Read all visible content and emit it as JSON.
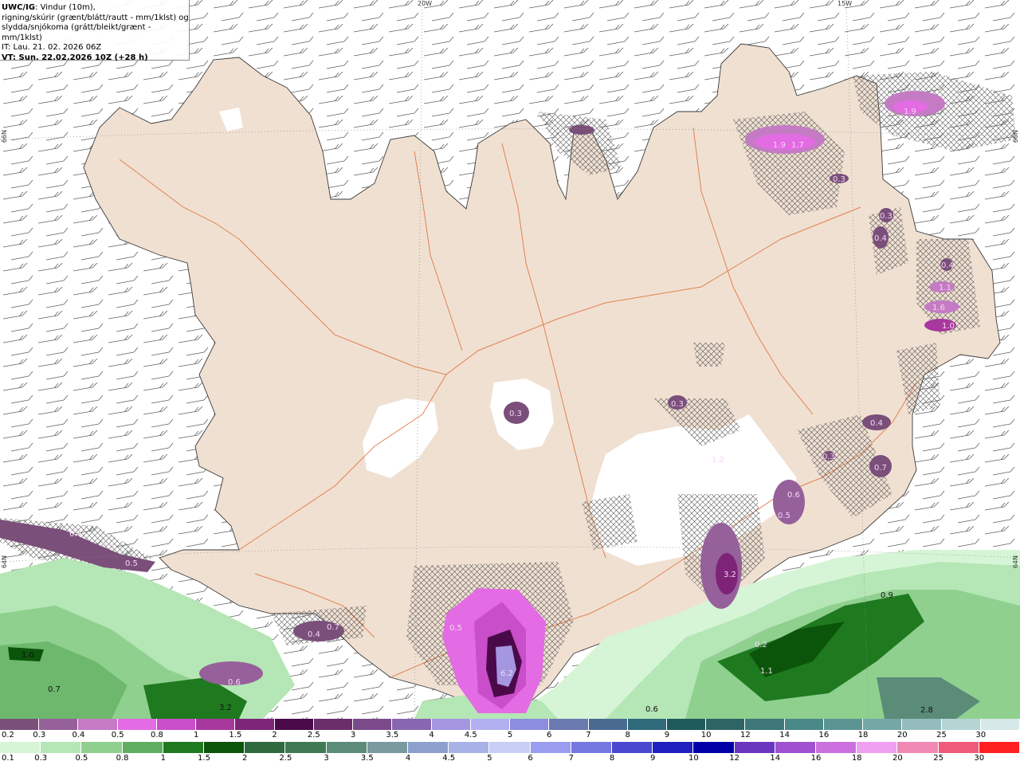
{
  "header": {
    "title_bold": "UWC/IG",
    "title_rest": ": Vindur (10m),",
    "line2": "rigning/skúrir (grænt/blátt/rautt - mm/1klst) og",
    "line3": "slydda/snjókoma (grátt/bleikt/grænt - mm/1klst)",
    "it_line": "IT: Lau. 21. 02. 2026 06Z",
    "vt_line": "VT: Sun. 22.02.2026 10Z (+28 h)"
  },
  "graticule": {
    "lon_20w": "20W",
    "lon_15w": "15W",
    "lat_66n_left": "66N",
    "lat_66n_right": "66N",
    "lat_64n_left": "64N",
    "lat_64n_right": "64N"
  },
  "map_values": {
    "ne_1": "1.9",
    "ne_2": "1.9",
    "ne_3": "1.7",
    "ne_4": "0.3",
    "e_1": "0.3",
    "e_2": "0.4",
    "e_3": "0.4",
    "e_4": "1.1",
    "e_5": "1.6",
    "e_6": "1.0",
    "c_1": "0.3",
    "c_2": "0.3",
    "c_3": "1.2",
    "c_4": "0.3",
    "c_5": "0.4",
    "c_6": "0.7",
    "se_1": "0.6",
    "se_2": "0.5",
    "se_3": "3.2",
    "w_1": "0.4",
    "w_2": "0.4",
    "w_3": "0.5",
    "s_1": "0.4",
    "s_2": "0.7",
    "s_3": "0.5",
    "s_4": "6.2",
    "sw_1": "1.0",
    "sw_2": "0.7",
    "sw_3": "0.6",
    "sw_4": "3.2",
    "sea_1": "0.9",
    "sea_2": "0.2",
    "sea_3": "1.1",
    "sea_4": "0.6",
    "sea_5": "2.8"
  },
  "legend_snow": {
    "labels": [
      "0.2",
      "0.3",
      "0.4",
      "0.5",
      "0.8",
      "1",
      "1.5",
      "2",
      "2.5",
      "3",
      "3.5",
      "4",
      "4.5",
      "5",
      "6",
      "7",
      "8",
      "9",
      "10",
      "12",
      "14",
      "16",
      "18",
      "20",
      "25",
      "30"
    ],
    "colors": [
      "#7a4f7a",
      "#96609a",
      "#c47bc4",
      "#e36be3",
      "#c94ec9",
      "#a8389e",
      "#7e2478",
      "#4a0a4a",
      "#6a2e6a",
      "#7a4a8a",
      "#8866b0",
      "#a496e0",
      "#b2b0f0",
      "#8c8ce0",
      "#6a7ab0",
      "#4a6a90",
      "#2f6a7a",
      "#1f5a5a",
      "#2e6464",
      "#3d7777",
      "#4a8888",
      "#5c9494",
      "#76a7a7",
      "#94bcbc",
      "#b6d4d4",
      "#d6e8e8"
    ]
  },
  "legend_rain": {
    "labels": [
      "0.1",
      "0.3",
      "0.5",
      "0.8",
      "1",
      "1.5",
      "2",
      "2.5",
      "3",
      "3.5",
      "4",
      "4.5",
      "5",
      "6",
      "7",
      "8",
      "9",
      "10",
      "12",
      "14",
      "16",
      "18",
      "20",
      "25",
      "30"
    ],
    "colors": [
      "#d6f5d6",
      "#b5e6b5",
      "#8fd08f",
      "#5fae5f",
      "#1f7a1f",
      "#0b550b",
      "#2f6a3f",
      "#3f7a55",
      "#5a8c77",
      "#7a9aa0",
      "#8ca0cc",
      "#a8b2e6",
      "#c8cef6",
      "#9a9cf0",
      "#7478e0",
      "#4848d0",
      "#2020c0",
      "#0000a8",
      "#6a36c0",
      "#a050d0",
      "#cc70e0",
      "#f0a0f0",
      "#f08ab4",
      "#f05a7a",
      "#ff2020"
    ]
  }
}
